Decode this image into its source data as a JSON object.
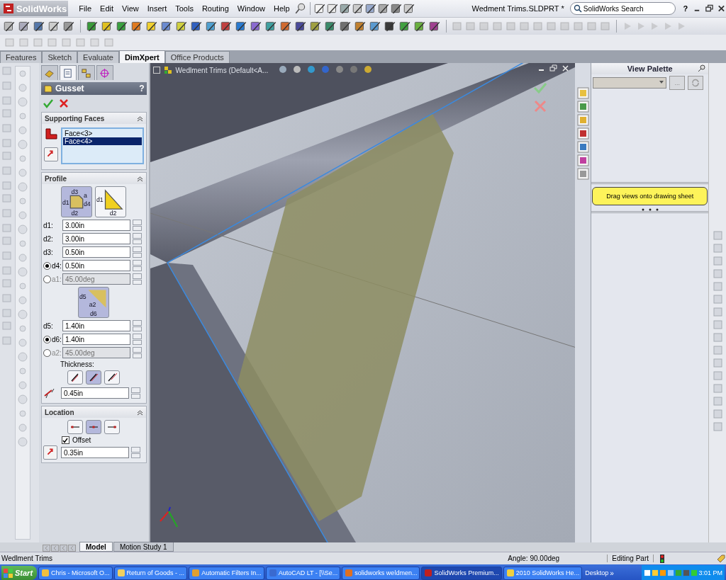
{
  "menu_bar": {
    "logo": "SolidWorks",
    "menus": [
      "File",
      "Edit",
      "View",
      "Insert",
      "Tools",
      "Routing",
      "Window",
      "Help"
    ],
    "document_title": "Wedment Trims.SLDPRT *",
    "search": {
      "placeholder": "SolidWorks Search"
    },
    "help": "?"
  },
  "command_tabs": [
    {
      "label": "Features",
      "selected": false
    },
    {
      "label": "Sketch",
      "selected": false
    },
    {
      "label": "Evaluate",
      "selected": false
    },
    {
      "label": "DimXpert",
      "selected": true
    },
    {
      "label": "Office Products",
      "selected": false
    }
  ],
  "property_manager": {
    "panel_tabs": [
      {
        "selected": false
      },
      {
        "selected": true
      },
      {
        "selected": false
      },
      {
        "selected": false
      }
    ],
    "title": "Gusset",
    "help": "?",
    "supporting_faces": {
      "title": "Supporting Faces",
      "items": [
        {
          "label": "Face<3>",
          "selected": false
        },
        {
          "label": "Face<4>",
          "selected": true
        }
      ]
    },
    "profile": {
      "title": "Profile",
      "types": [
        {
          "labels": [
            "d3",
            "d1",
            "a",
            "d4",
            "d2"
          ],
          "selected": true
        },
        {
          "labels": [
            "d1",
            "d2"
          ],
          "selected": false
        }
      ],
      "fields": [
        {
          "label": "d1:",
          "value": "3.00in",
          "kind": "text",
          "disabled": false
        },
        {
          "label": "d2:",
          "value": "3.00in",
          "kind": "text",
          "disabled": false
        },
        {
          "label": "d3:",
          "value": "0.50in",
          "kind": "text",
          "disabled": false
        },
        {
          "label": "d4:",
          "value": "0.50in",
          "kind": "radio",
          "selected": true,
          "disabled": false
        },
        {
          "label": "a1:",
          "value": "45.00deg",
          "kind": "radio",
          "selected": false,
          "disabled": true
        }
      ],
      "chamfer": {
        "labels": [
          "d5",
          "a2",
          "d6"
        ],
        "selected": true
      },
      "chamfer_fields": [
        {
          "label": "d5:",
          "value": "1.40in",
          "kind": "text",
          "disabled": false
        },
        {
          "label": "d6:",
          "value": "1.40in",
          "kind": "radio",
          "selected": true,
          "disabled": false
        },
        {
          "label": "a2:",
          "value": "45.00deg",
          "kind": "radio",
          "selected": false,
          "disabled": true
        }
      ],
      "thickness_label": "Thickness:",
      "thickness_options": [
        {
          "selected": false
        },
        {
          "selected": true
        },
        {
          "selected": false
        }
      ],
      "thickness": {
        "value": "0.45in"
      }
    },
    "location": {
      "title": "Location",
      "options": [
        {
          "selected": false
        },
        {
          "selected": true
        },
        {
          "selected": false
        }
      ],
      "offset": {
        "label": "Offset",
        "checked": true
      },
      "distance": {
        "value": "0.35in"
      }
    }
  },
  "viewport": {
    "tree_root": "Wedlment Trims (Default<A..."
  },
  "view_palette": {
    "title": "View Palette",
    "browse": "...",
    "tip": "Drag views onto drawing sheet"
  },
  "bottom_tabs": [
    {
      "label": "Model",
      "selected": true
    },
    {
      "label": "Motion Study 1",
      "selected": false
    }
  ],
  "status_bar": {
    "document": "Wedlment Trims",
    "angle": "Angle: 90.00deg",
    "mode": "Editing Part"
  },
  "taskbar": {
    "start": "Start",
    "tasks": [
      {
        "label": "Chris - Microsoft O...",
        "selected": false
      },
      {
        "label": "Return of Goods - ...",
        "selected": false
      },
      {
        "label": "Automatic Filters In...",
        "selected": false
      },
      {
        "label": "AutoCAD LT - [\\\\Se...",
        "selected": false
      },
      {
        "label": "solidworks weldmen...",
        "selected": false
      },
      {
        "label": "SolidWorks Premium...",
        "selected": true
      },
      {
        "label": "2010 SolidWorks He...",
        "selected": false
      }
    ],
    "desktop": "Desktop",
    "overflow": "»",
    "clock": "3:01 PM"
  }
}
